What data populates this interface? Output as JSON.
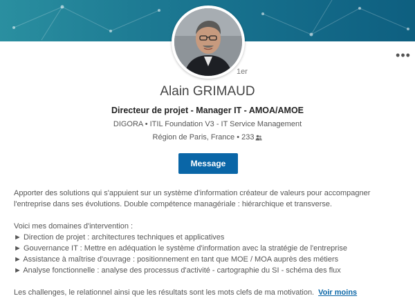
{
  "profile": {
    "name": "Alain GRIMAUD",
    "degree": "1er",
    "headline": "Directeur de projet - Manager IT - AMOA/AMOE",
    "company_line": "DIGORA • ITIL Foundation V3 - IT Service Management",
    "location": "Région de Paris, France",
    "separator": " • ",
    "connections": "233",
    "connections_icon": "people-icon"
  },
  "actions": {
    "message_label": "Message",
    "more_label": "•••"
  },
  "summary": {
    "paragraph1_line1": "Apporter des solutions qui s'appuient sur un système d'information créateur de valeurs pour accompagner",
    "paragraph1_line2": "l'entreprise dans ses évolutions. Double compétence managériale : hiérarchique et transverse.",
    "domains_intro": "Voici mes domaines d'intervention :",
    "domains": [
      "► Direction de projet : architectures techniques et applicatives",
      "► Gouvernance IT : Mettre en adéquation le système d'information avec la stratégie de l'entreprise",
      "► Assistance à maîtrise d'ouvrage : positionnement en tant que MOE / MOA auprès des métiers",
      "► Analyse fonctionnelle : analyse des processus d'activité - cartographie du SI - schéma des flux"
    ],
    "closing": "Les challenges, le relationnel ainsi que les résultats sont les mots clefs de ma motivation.",
    "see_less": "Voir moins"
  },
  "colors": {
    "banner": "#1d7a93",
    "primary_button": "#0a66a7",
    "link": "#0a66a7"
  }
}
